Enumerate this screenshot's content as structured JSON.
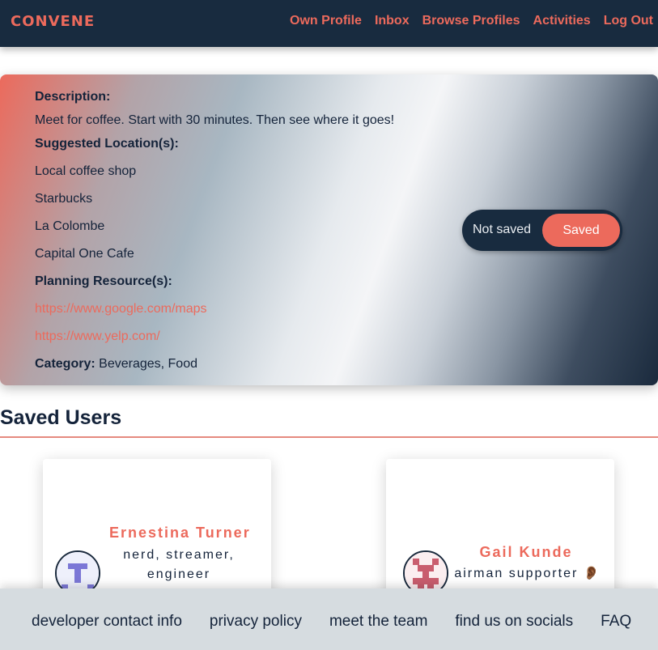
{
  "brand": "CONVENE",
  "nav": [
    "Own Profile",
    "Inbox",
    "Browse Profiles",
    "Activities",
    "Log Out"
  ],
  "activity": {
    "description_label": "Description:",
    "description": "Meet for coffee. Start with 30 minutes. Then see where it goes!",
    "locations_label": "Suggested Location(s):",
    "locations": [
      "Local coffee shop",
      "Starbucks",
      "La Colombe",
      "Capital One Cafe"
    ],
    "resources_label": "Planning Resource(s):",
    "resources": [
      "https://www.google.com/maps",
      "https://www.yelp.com/"
    ],
    "category_label": "Category:",
    "category": "Beverages, Food"
  },
  "toggle": {
    "off_label": "Not saved",
    "on_label": "Saved",
    "state": "Saved"
  },
  "saved_users": {
    "title": "Saved Users",
    "users": [
      {
        "name": "Ernestina Turner",
        "tagline": "nerd, streamer, engineer",
        "avatar_icon": "letter-t-identicon",
        "avatar_color": "#7b77d6"
      },
      {
        "name": "Gail Kunde",
        "tagline": "airman supporter 👂🏾",
        "avatar_icon": "pattern-identicon",
        "avatar_color": "#c95d6e"
      }
    ]
  },
  "footer": [
    "developer contact info",
    "privacy policy",
    "meet the team",
    "find us on socials",
    "FAQ"
  ],
  "colors": {
    "accent": "#ec6a5c",
    "navy": "#182b3f",
    "footer_bg": "#d6dce0"
  }
}
